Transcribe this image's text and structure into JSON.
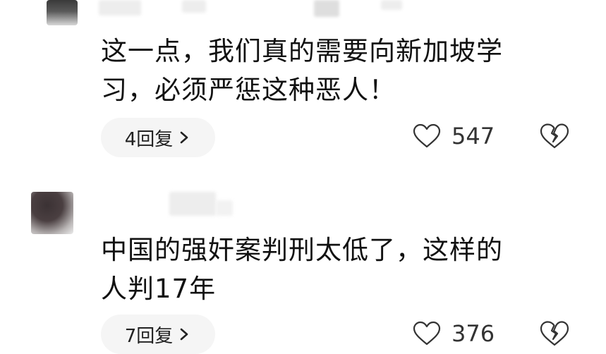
{
  "comments": [
    {
      "text_line1": "这一点，我们真的需要向新加坡学",
      "text_line2": "习，必须严惩这种恶人！",
      "reply_label": "4回复",
      "like_count": "547",
      "icons": {
        "like": "heart-outline-icon",
        "dislike": "broken-heart-icon",
        "reply_arrow": "chevron-right-icon"
      }
    },
    {
      "text_line1": "中国的强奸案判刑太低了，这样的",
      "text_line2": "人判17年",
      "reply_label": "7回复",
      "like_count": "376",
      "icons": {
        "like": "heart-outline-icon",
        "dislike": "broken-heart-icon",
        "reply_arrow": "chevron-right-icon"
      }
    }
  ],
  "colors": {
    "text": "#111111",
    "pill_background": "#f5f5f5",
    "icon_stroke": "#333333"
  }
}
